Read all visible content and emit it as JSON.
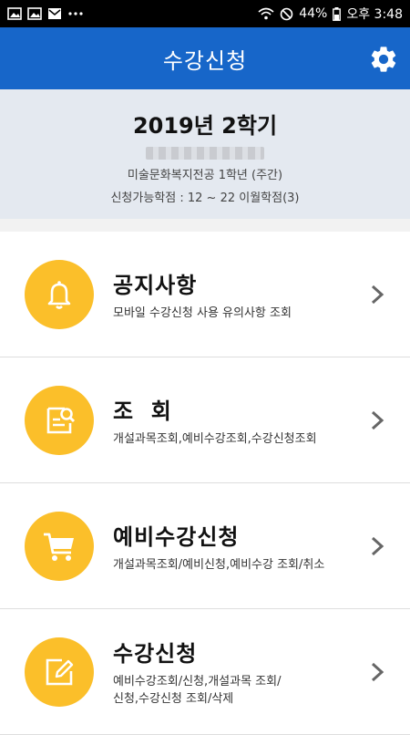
{
  "status_bar": {
    "battery": "44%",
    "time": "오후 3:48",
    "icons": [
      "image-icon",
      "image-icon",
      "mail-icon",
      "more-icon",
      "wifi-icon",
      "do-not-disturb-icon",
      "battery-icon"
    ]
  },
  "header": {
    "title": "수강신청",
    "settings_icon": "gear-icon"
  },
  "info": {
    "semester": "2019년 2학기",
    "department": "미술문화복지전공  1학년  (주간)",
    "credits": "신청가능학점 :   12 ~ 22 이월학점(3)"
  },
  "menu": [
    {
      "title": "공지사항",
      "subtitle": "모바일 수강신청 사용 유의사항 조회",
      "icon": "bell-icon"
    },
    {
      "title": "조  회",
      "subtitle": "개설과목조회,예비수강조회,수강신청조회",
      "icon": "search-document-icon"
    },
    {
      "title": "예비수강신청",
      "subtitle": "개설과목조회/예비신청,예비수강 조회/취소",
      "icon": "cart-icon"
    },
    {
      "title": "수강신청",
      "subtitle": "예비수강조회/신청,개설과목 조회/\n신청,수강신청 조회/삭제",
      "icon": "edit-icon"
    }
  ],
  "colors": {
    "app_bar": "#1766c9",
    "icon_circle": "#fbbf2a",
    "info_bg": "#e4e9f0"
  }
}
